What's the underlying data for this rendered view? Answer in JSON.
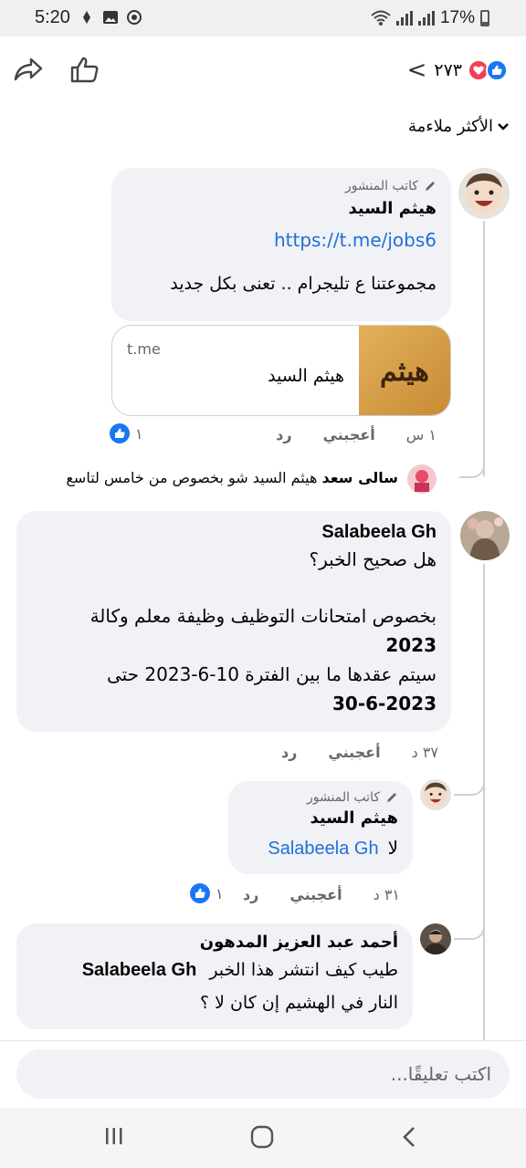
{
  "status": {
    "time": "5:20",
    "battery": "17%"
  },
  "header": {
    "reaction_count": "٢٧٣"
  },
  "sort": {
    "label": "الأكثر ملاءمة"
  },
  "comments": [
    {
      "badge": "كاتب المنشور",
      "author": "هيثم السيد",
      "link": "https://t.me/jobs6",
      "text": "مجموعتنا ع تليجرام .. تعنى بكل جديد",
      "preview": {
        "domain": "t.me",
        "title": "هيثم السيد",
        "logo_text": "هيثم"
      },
      "time": "١ س",
      "like_label": "أعجبني",
      "reply_label": "رد",
      "likes": "١"
    },
    {
      "reply_preview_author": "سالى سعد",
      "reply_preview_text": "هيثم السيد شو بخصوص من خامس لتاسع"
    },
    {
      "author": "Salabeela Gh",
      "line1": "هل صحيح الخبر؟",
      "line2": "بخصوص امتحانات التوظيف وظيفة معلم وكالة",
      "line3": "2023",
      "line4": "سيتم عقدها ما بين الفترة 10-6-2023 حتى",
      "line5": "30-6-2023",
      "time": "٣٧ د",
      "like_label": "أعجبني",
      "reply_label": "رد"
    },
    {
      "badge": "كاتب المنشور",
      "author": "هيثم السيد",
      "text": "لا",
      "mention": "Salabeela Gh",
      "time": "٣١ د",
      "like_label": "أعجبني",
      "reply_label": "رد",
      "likes": "١"
    },
    {
      "author": "أحمد عبد العزيز المدهون",
      "mention": "Salabeela Gh",
      "line1": "طيب كيف انتشر هذا الخبر",
      "line2": "النار في الهشيم إن كان لا ؟"
    }
  ],
  "composer": {
    "placeholder": "اكتب تعليقًا..."
  }
}
